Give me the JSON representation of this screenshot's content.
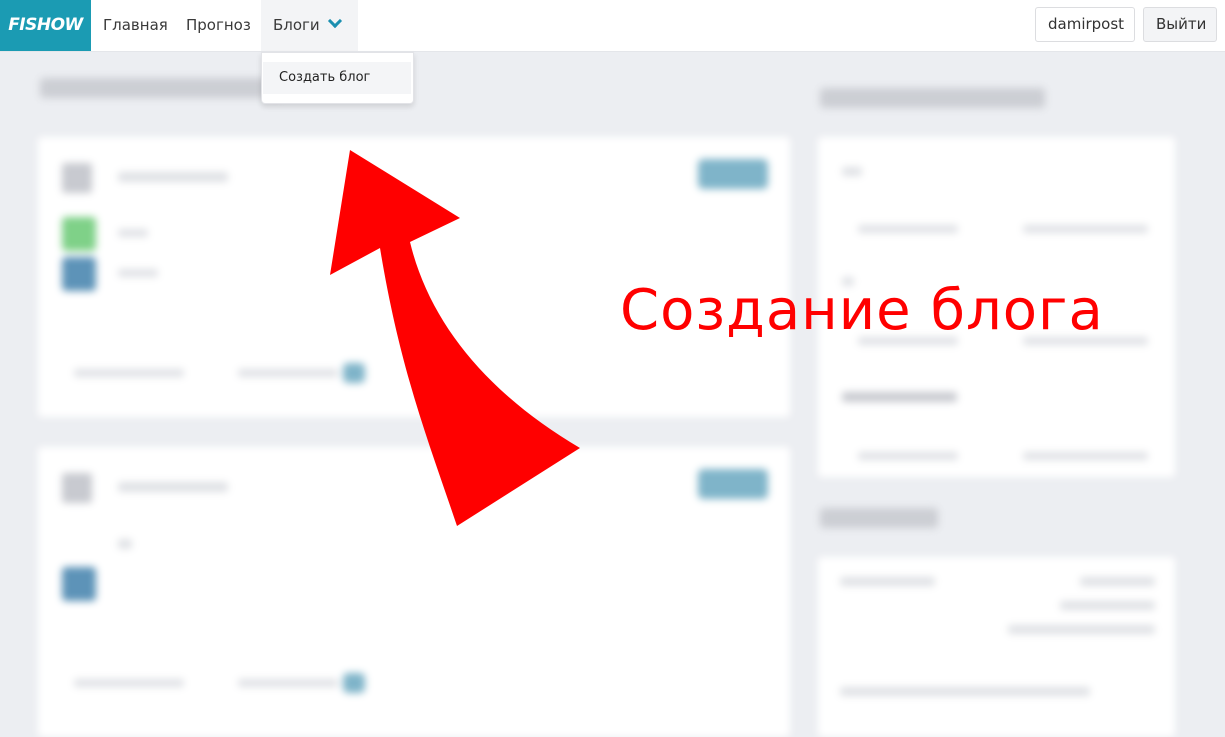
{
  "logo": {
    "text": "FISHOW"
  },
  "nav": {
    "home": "Главная",
    "forecast": "Прогноз",
    "blogs": "Блоги",
    "user": "damirpost",
    "logout": "Выйти"
  },
  "dropdown": {
    "items": [
      {
        "label": "Создать блог"
      }
    ]
  },
  "annotation": {
    "text": "Создание блога"
  },
  "colors": {
    "brand": "#1b9bb3",
    "annotation": "#ff0000",
    "background": "#eceef2"
  }
}
